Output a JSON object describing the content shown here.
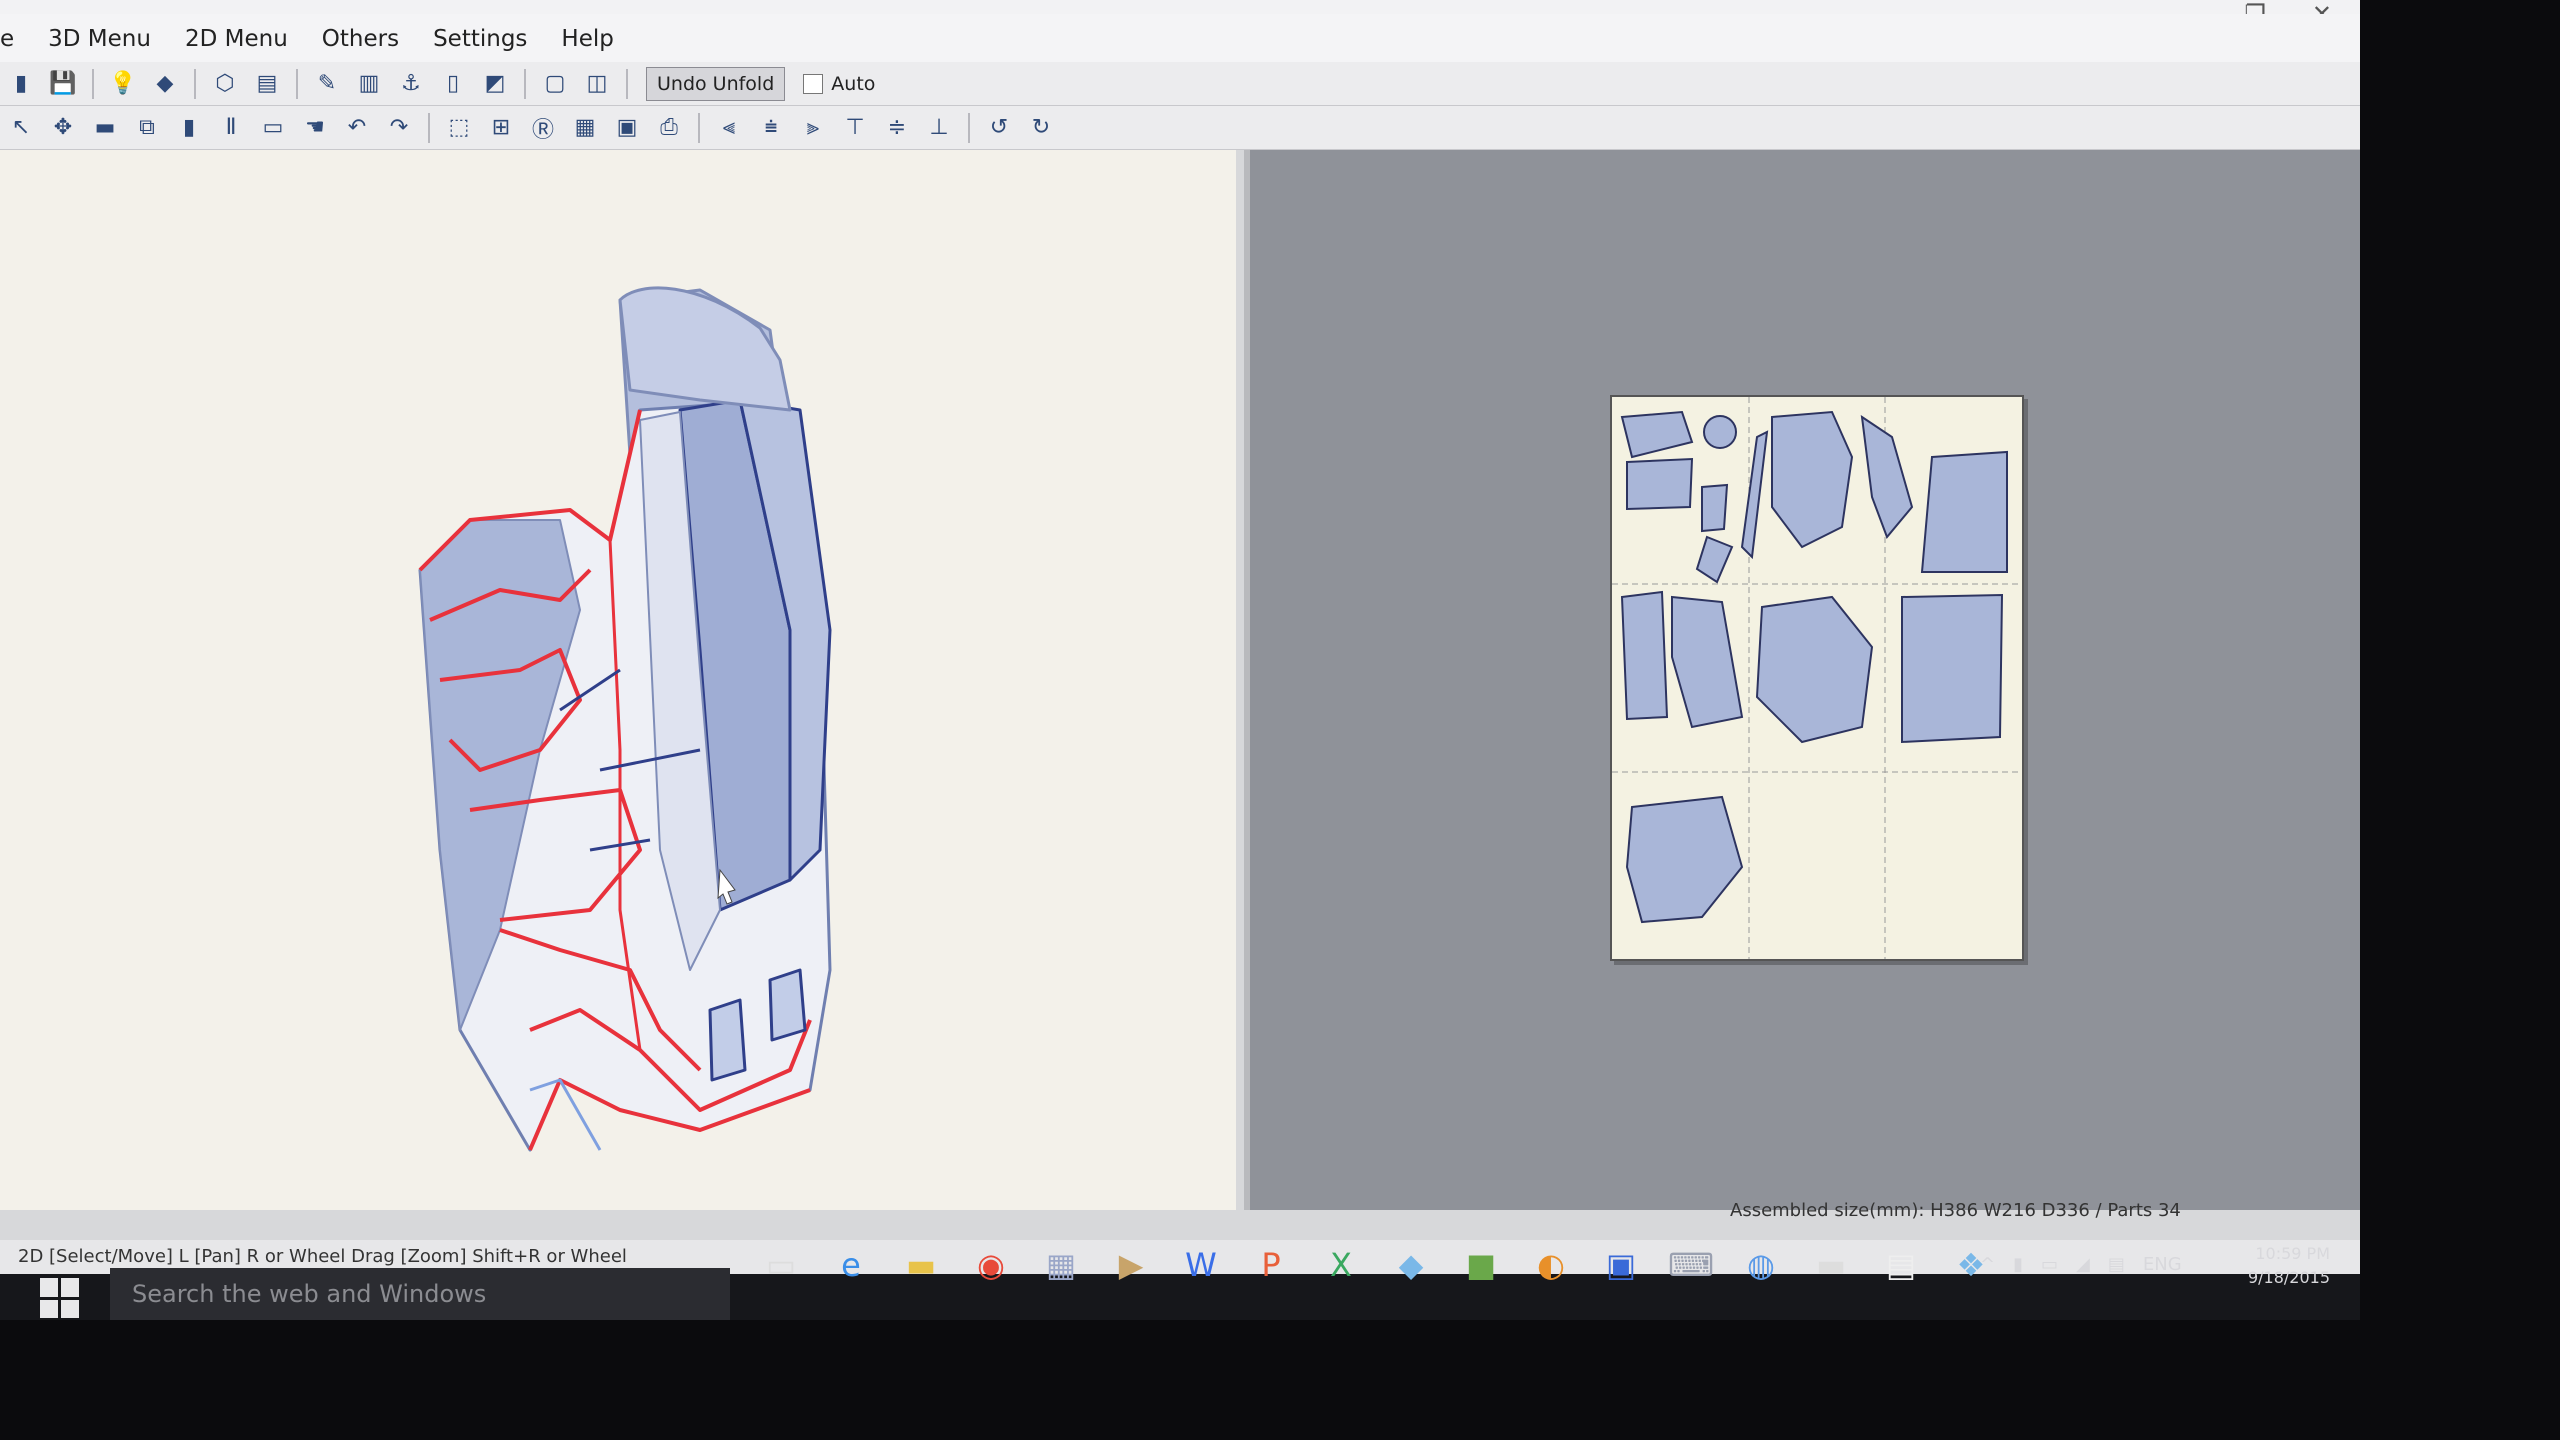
{
  "menubar": {
    "items": [
      {
        "label": "e"
      },
      {
        "label": "3D Menu"
      },
      {
        "label": "2D Menu"
      },
      {
        "label": "Others"
      },
      {
        "label": "Settings"
      },
      {
        "label": "Help"
      }
    ]
  },
  "window_controls": {
    "minimize": "–",
    "restore": "❐",
    "close": "✕"
  },
  "toolbar": {
    "undo_unfold_label": "Undo Unfold",
    "auto_label": "Auto"
  },
  "status": {
    "left_text": "2D [Select/Move] L [Pan] R or Wheel Drag [Zoom] Shift+R or Wheel",
    "right_text": "Assembled size(mm): H386 W216 D336 / Parts 34"
  },
  "taskbar": {
    "search_placeholder": "Search the web and Windows",
    "tray_language": "ENG",
    "clock_time": "10:59 PM",
    "clock_date": "9/18/2015"
  },
  "colors": {
    "cut_line": "#e8323c",
    "part_fill": "#a9b6d8",
    "paper": "#f4f2e2",
    "unfold_background": "#8f9299"
  }
}
